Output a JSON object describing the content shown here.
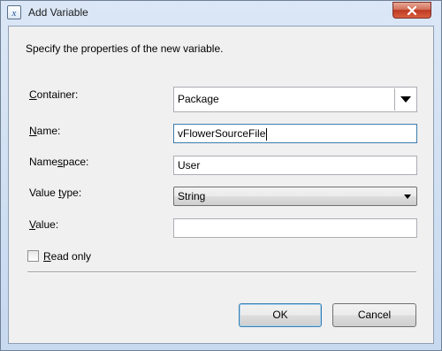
{
  "window": {
    "title": "Add Variable"
  },
  "dialog": {
    "instruction": "Specify the properties of the new variable.",
    "container": {
      "label_underlined": "C",
      "label_rest": "ontainer:",
      "value": "Package"
    },
    "name": {
      "label_underlined": "N",
      "label_rest": "ame:",
      "value": "vFlowerSourceFile"
    },
    "namespace": {
      "label_before": "Name",
      "label_underlined": "s",
      "label_rest": "pace:",
      "value": "User"
    },
    "value_type": {
      "label_before": "Value ",
      "label_underlined": "t",
      "label_rest": "ype:",
      "value": "String"
    },
    "value": {
      "label_underlined": "V",
      "label_rest": "alue:",
      "value": ""
    },
    "read_only": {
      "label_underlined": "R",
      "label_rest": "ead only",
      "checked": false
    },
    "ok_label": "OK",
    "cancel_label": "Cancel"
  }
}
